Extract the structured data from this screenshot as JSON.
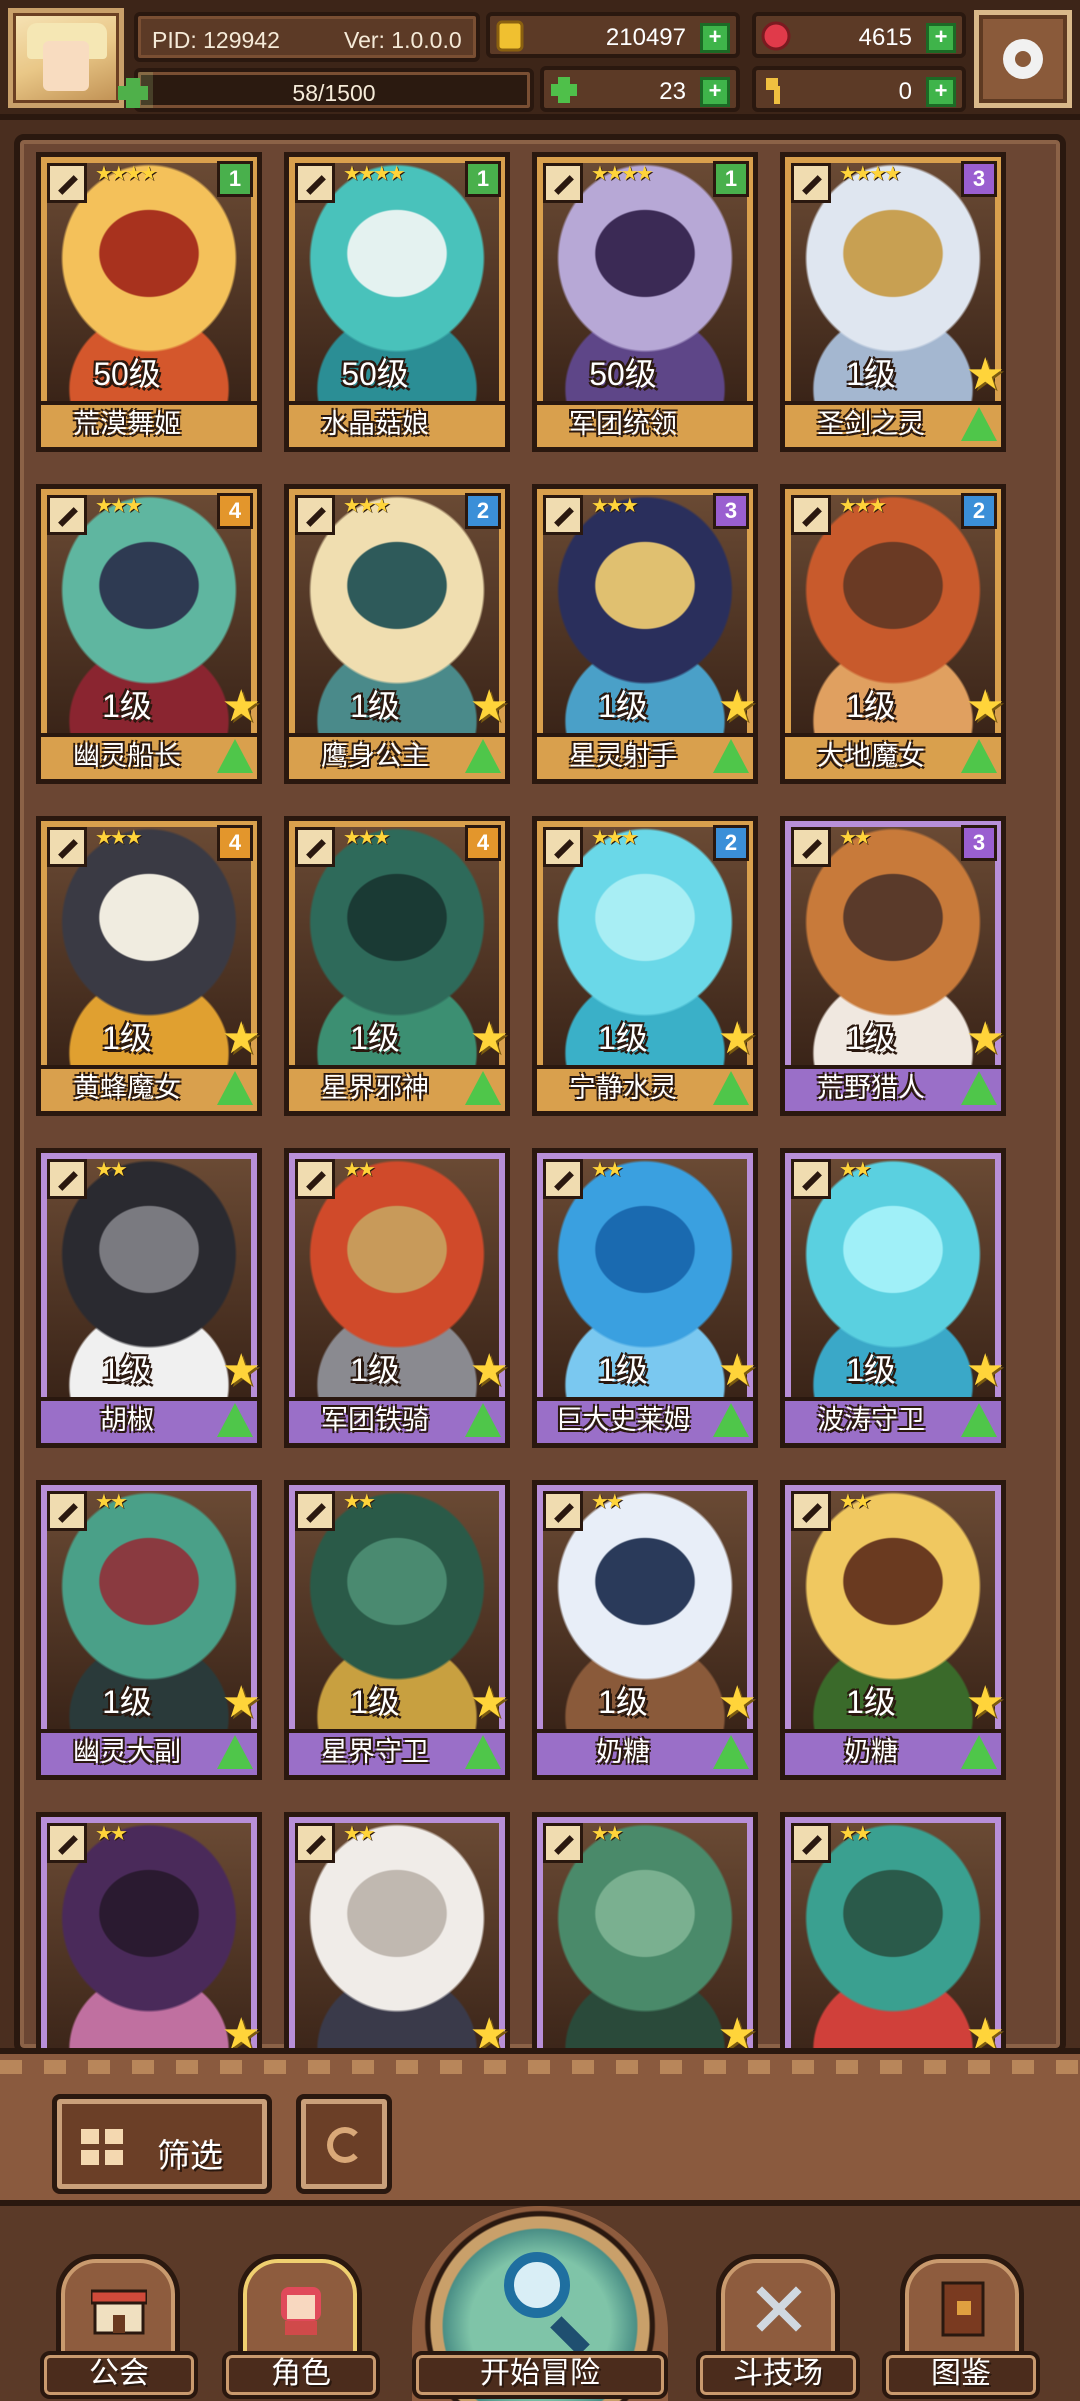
{
  "header": {
    "pid": "PID: 129942",
    "version": "Ver: 1.0.0.0",
    "exp": "58/1500",
    "exp_fraction": 0.039,
    "gold": "210497",
    "gems": "4615",
    "clover": "23",
    "keys": "0"
  },
  "cards": [
    {
      "level": "50级",
      "name": "荒漠舞姬",
      "stars": "★★★★",
      "badge": "1",
      "badge_color": "green",
      "frame": "gold",
      "upstar": false,
      "art": [
        "#f4c15a",
        "#d4572c",
        "#a8321e"
      ]
    },
    {
      "level": "50级",
      "name": "水晶菇娘",
      "stars": "★★★★",
      "badge": "1",
      "badge_color": "green",
      "frame": "gold",
      "upstar": false,
      "art": [
        "#49c2bb",
        "#2b8e95",
        "#e4f2f0"
      ]
    },
    {
      "level": "50级",
      "name": "军团统领",
      "stars": "★★★★",
      "badge": "1",
      "badge_color": "green",
      "frame": "gold",
      "upstar": false,
      "art": [
        "#b7a8d6",
        "#5e4688",
        "#3b2a55"
      ]
    },
    {
      "level": "1级",
      "name": "圣剑之灵",
      "stars": "★★★★",
      "badge": "3",
      "badge_color": "purple",
      "frame": "gold",
      "upstar": true,
      "art": [
        "#dfe6f0",
        "#a4b7d0",
        "#c8a052"
      ]
    },
    {
      "level": "1级",
      "name": "幽灵船长",
      "stars": "★★★",
      "badge": "4",
      "badge_color": "orange",
      "frame": "gold",
      "upstar": true,
      "art": [
        "#5fb6a0",
        "#8a2530",
        "#2e3a52"
      ]
    },
    {
      "level": "1级",
      "name": "鹰身公主",
      "stars": "★★★",
      "badge": "2",
      "badge_color": "blue",
      "frame": "gold",
      "upstar": true,
      "art": [
        "#f0deb0",
        "#4a8a8a",
        "#2e5a5a"
      ]
    },
    {
      "level": "1级",
      "name": "星灵射手",
      "stars": "★★★",
      "badge": "3",
      "badge_color": "purple",
      "frame": "gold",
      "upstar": true,
      "art": [
        "#2a2f5c",
        "#4aa0c8",
        "#e0c070"
      ]
    },
    {
      "level": "1级",
      "name": "大地魔女",
      "stars": "★★★",
      "badge": "2",
      "badge_color": "blue",
      "frame": "gold",
      "upstar": true,
      "art": [
        "#c85a2c",
        "#e0a060",
        "#6a3a24"
      ]
    },
    {
      "level": "1级",
      "name": "黄蜂魔女",
      "stars": "★★★",
      "badge": "4",
      "badge_color": "orange",
      "frame": "gold",
      "upstar": true,
      "art": [
        "#3a3a44",
        "#e0a030",
        "#f0ece0"
      ]
    },
    {
      "level": "1级",
      "name": "星界邪神",
      "stars": "★★★",
      "badge": "4",
      "badge_color": "orange",
      "frame": "gold",
      "upstar": true,
      "art": [
        "#2e6a5a",
        "#3c8f72",
        "#1a3a34"
      ]
    },
    {
      "level": "1级",
      "name": "宁静水灵",
      "stars": "★★★",
      "badge": "2",
      "badge_color": "blue",
      "frame": "gold",
      "upstar": true,
      "art": [
        "#6ad8e8",
        "#3ab0c8",
        "#a8eef4"
      ]
    },
    {
      "level": "1级",
      "name": "荒野猎人",
      "stars": "★★",
      "badge": "3",
      "badge_color": "purple",
      "frame": "purple",
      "upstar": true,
      "art": [
        "#c87a3a",
        "#f0e8e0",
        "#5a3a2a"
      ]
    },
    {
      "level": "1级",
      "name": "胡椒",
      "stars": "★★",
      "badge": "",
      "badge_color": "",
      "frame": "purple",
      "upstar": true,
      "art": [
        "#2a2a30",
        "#f0f0f0",
        "#7a7a80"
      ]
    },
    {
      "level": "1级",
      "name": "军团铁骑",
      "stars": "★★",
      "badge": "",
      "badge_color": "",
      "frame": "purple",
      "upstar": true,
      "art": [
        "#d04a2a",
        "#8a8a90",
        "#c89a5a"
      ]
    },
    {
      "level": "1级",
      "name": "巨大史莱姆",
      "stars": "★★",
      "badge": "",
      "badge_color": "",
      "frame": "purple",
      "upstar": true,
      "art": [
        "#3aa0e0",
        "#7ac8f0",
        "#1a6ab0"
      ]
    },
    {
      "level": "1级",
      "name": "波涛守卫",
      "stars": "★★",
      "badge": "",
      "badge_color": "",
      "frame": "purple",
      "upstar": true,
      "art": [
        "#5ad0e0",
        "#3aa8c8",
        "#a0f0f8"
      ]
    },
    {
      "level": "1级",
      "name": "幽灵大副",
      "stars": "★★",
      "badge": "",
      "badge_color": "",
      "frame": "purple",
      "upstar": true,
      "art": [
        "#4aa088",
        "#2a3a3a",
        "#8a3a40"
      ]
    },
    {
      "level": "1级",
      "name": "星界守卫",
      "stars": "★★",
      "badge": "",
      "badge_color": "",
      "frame": "purple",
      "upstar": true,
      "art": [
        "#2a5a48",
        "#c8a040",
        "#4a8a70"
      ]
    },
    {
      "level": "1级",
      "name": "奶糖",
      "stars": "★★",
      "badge": "",
      "badge_color": "",
      "frame": "purple",
      "upstar": true,
      "art": [
        "#e8eef8",
        "#8a5a3a",
        "#2a3a5a"
      ]
    },
    {
      "level": "1级",
      "name": "奶糖",
      "stars": "★★",
      "badge": "",
      "badge_color": "",
      "frame": "purple",
      "upstar": true,
      "art": [
        "#f0c860",
        "#3a6a2a",
        "#6a3a20"
      ]
    },
    {
      "level": "",
      "name": "",
      "stars": "★★",
      "badge": "",
      "badge_color": "",
      "frame": "purple",
      "upstar": true,
      "art": [
        "#4a2a5a",
        "#c070a0",
        "#2a1a30"
      ]
    },
    {
      "level": "",
      "name": "",
      "stars": "★★",
      "badge": "",
      "badge_color": "",
      "frame": "purple",
      "upstar": true,
      "art": [
        "#f0ece8",
        "#3a3a4a",
        "#c0b8b0"
      ]
    },
    {
      "level": "",
      "name": "",
      "stars": "★★",
      "badge": "",
      "badge_color": "",
      "frame": "purple",
      "upstar": true,
      "art": [
        "#4a8a6a",
        "#2a4a3a",
        "#7ab090"
      ]
    },
    {
      "level": "",
      "name": "",
      "stars": "★★",
      "badge": "",
      "badge_color": "",
      "frame": "purple",
      "upstar": true,
      "art": [
        "#3aa090",
        "#d0403a",
        "#2a5a4a"
      ]
    }
  ],
  "toolbar": {
    "filter_label": "筛选"
  },
  "nav": {
    "guild": "公会",
    "characters": "角色",
    "adventure": "开始冒险",
    "arena": "斗技场",
    "codex": "图鉴"
  }
}
